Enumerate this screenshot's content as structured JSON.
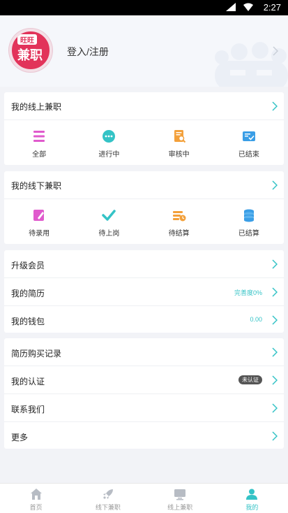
{
  "status_bar": {
    "time": "2:27"
  },
  "profile": {
    "logo_text_top": "旺旺",
    "logo_text_main": "兼职",
    "login_label": "登入/注册"
  },
  "online_jobs": {
    "title": "我的线上兼职",
    "items": [
      {
        "label": "全部",
        "icon": "list-icon",
        "color": "#e05acd"
      },
      {
        "label": "进行中",
        "icon": "chat-dots-icon",
        "color": "#34c3c6"
      },
      {
        "label": "审核中",
        "icon": "document-search-icon",
        "color": "#f3a03a"
      },
      {
        "label": "已结束",
        "icon": "card-check-icon",
        "color": "#3a9ee6"
      }
    ]
  },
  "offline_jobs": {
    "title": "我的线下兼职",
    "items": [
      {
        "label": "待录用",
        "icon": "edit-note-icon",
        "color": "#e05acd"
      },
      {
        "label": "待上岗",
        "icon": "checkmark-icon",
        "color": "#34c3c6"
      },
      {
        "label": "待结算",
        "icon": "calc-clock-icon",
        "color": "#f3a03a"
      },
      {
        "label": "已结算",
        "icon": "coin-stack-icon",
        "color": "#3a9ee6"
      }
    ]
  },
  "account_menu": {
    "upgrade": "升级会员",
    "resume": "我的简历",
    "resume_value": "完善度0%",
    "wallet": "我的钱包",
    "wallet_value": "0.00"
  },
  "other_menu": {
    "purchase_records": "简历购买记录",
    "certification": "我的认证",
    "certification_badge": "未认证",
    "contact": "联系我们",
    "more": "更多"
  },
  "tab_bar": {
    "tabs": [
      {
        "label": "首页",
        "icon": "home-icon",
        "active": false
      },
      {
        "label": "线下兼职",
        "icon": "rocket-icon",
        "active": false
      },
      {
        "label": "线上兼职",
        "icon": "monitor-icon",
        "active": false
      },
      {
        "label": "我的",
        "icon": "person-icon",
        "active": true
      }
    ]
  },
  "colors": {
    "accent": "#34c3c6",
    "brand": "#e2335a",
    "pink": "#e05acd",
    "orange": "#f3a03a",
    "blue": "#3a9ee6"
  }
}
